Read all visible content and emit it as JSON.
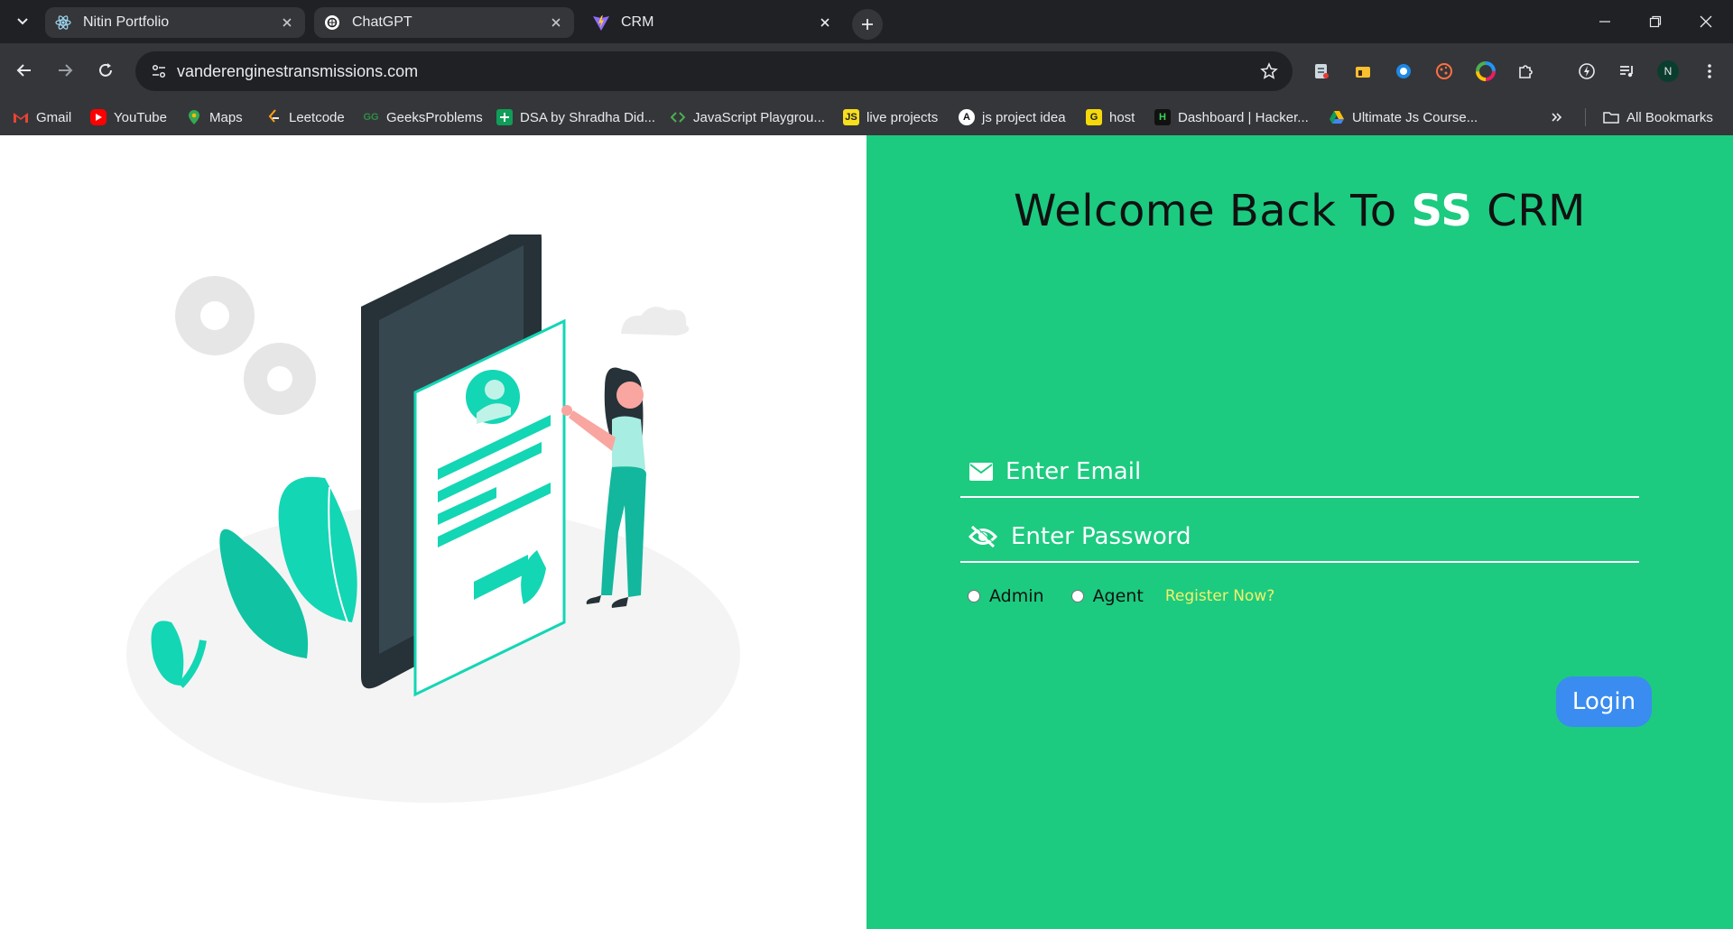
{
  "tabs": [
    {
      "title": "Nitin Portfolio",
      "icon": "react-icon"
    },
    {
      "title": "ChatGPT",
      "icon": "chatgpt-icon"
    },
    {
      "title": "CRM",
      "icon": "vite-icon"
    }
  ],
  "toolbar": {
    "url": "vanderenginestransmissions.com",
    "profile_initial": "N"
  },
  "bookmarks": [
    {
      "label": "Gmail",
      "icon": "gmail-icon"
    },
    {
      "label": "YouTube",
      "icon": "youtube-icon"
    },
    {
      "label": "Maps",
      "icon": "maps-icon"
    },
    {
      "label": "Leetcode",
      "icon": "leetcode-icon"
    },
    {
      "label": "GeeksProblems",
      "icon": "geeksforgeeks-icon"
    },
    {
      "label": "DSA by Shradha Did...",
      "icon": "sheets-icon"
    },
    {
      "label": "JavaScript Playgrou...",
      "icon": "playground-icon"
    },
    {
      "label": "live projects",
      "icon": "js-icon"
    },
    {
      "label": "js project idea",
      "icon": "dev-icon"
    },
    {
      "label": "host",
      "icon": "host-icon"
    },
    {
      "label": "Dashboard | Hacker...",
      "icon": "hackerrank-icon"
    },
    {
      "label": "Ultimate Js Course...",
      "icon": "drive-icon"
    }
  ],
  "all_bookmarks": "All Bookmarks",
  "login_page": {
    "welcome_prefix": "Welcome Back To ",
    "welcome_brand": "SS",
    "welcome_suffix": " CRM",
    "email_placeholder": "Enter Email",
    "password_placeholder": "Enter Password",
    "roles": [
      "Admin",
      "Agent"
    ],
    "register_link": "Register Now?",
    "login_button": "Login"
  },
  "colors": {
    "panel_green": "#1ccb80",
    "login_blue": "#3a8cf0",
    "register_yellow": "#f4f16a",
    "illustration_teal": "#13d6b4"
  }
}
